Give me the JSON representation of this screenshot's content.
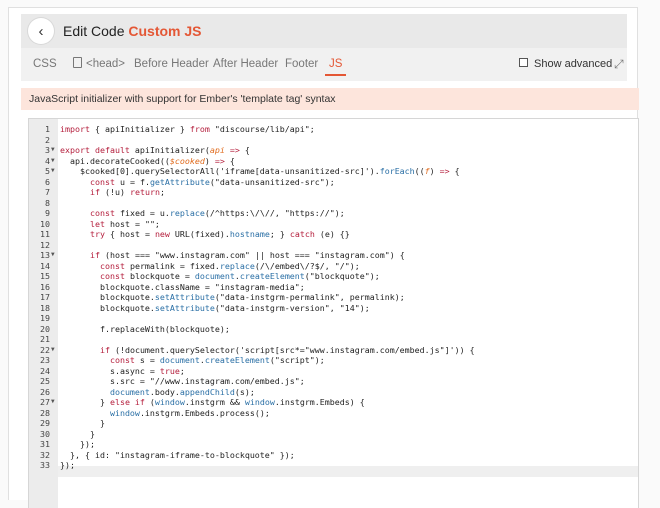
{
  "header": {
    "title_prefix": "Edit Code",
    "title_accent": "Custom JS",
    "back_icon": "chevron-left-icon"
  },
  "tabs": [
    {
      "label": "CSS",
      "active": false
    },
    {
      "label": "<head>",
      "active": false
    },
    {
      "label": "Before Header",
      "active": false
    },
    {
      "label": "After Header",
      "active": false
    },
    {
      "label": "Footer",
      "active": false
    },
    {
      "label": "JS",
      "active": true
    }
  ],
  "show_advanced": {
    "label": "Show advanced",
    "checked": false
  },
  "description": "JavaScript initializer with support for Ember's 'template tag' syntax",
  "colors": {
    "accent": "#e45735",
    "desc_bg": "#fde5dc"
  },
  "editor": {
    "active_line": 33,
    "lines": [
      {
        "n": "1",
        "fold": false,
        "html": "<span class=\"kw\">import</span> { apiInitializer } <span class=\"kw\">from</span> \"discourse/lib/api\";"
      },
      {
        "n": "2",
        "fold": false,
        "html": ""
      },
      {
        "n": "3",
        "fold": true,
        "html": "<span class=\"kw\">export default</span> apiInitializer(<span class=\"param\">api</span> <span class=\"kw\">=&gt;</span> {"
      },
      {
        "n": "4",
        "fold": true,
        "html": "  api.decorateCooked((<span class=\"param\">$cooked</span>) <span class=\"kw\">=&gt;</span> {"
      },
      {
        "n": "5",
        "fold": true,
        "html": "    $cooked[0].querySelectorAll('iframe[data-unsanitized-src]').<span class=\"fn\">forEach</span>((<span class=\"param\">f</span>) <span class=\"kw\">=&gt;</span> {"
      },
      {
        "n": "6",
        "fold": false,
        "html": "      <span class=\"kw\">const</span> u = f.<span class=\"fn\">getAttribute</span>(\"data-unsanitized-src\");"
      },
      {
        "n": "7",
        "fold": false,
        "html": "      <span class=\"kw\">if</span> (!u) <span class=\"kw\">return</span>;"
      },
      {
        "n": "8",
        "fold": false,
        "html": ""
      },
      {
        "n": "9",
        "fold": false,
        "html": "      <span class=\"kw\">const</span> fixed = u.<span class=\"fn\">replace</span>(/^https:\\/\\//, \"https://\");"
      },
      {
        "n": "10",
        "fold": false,
        "html": "      <span class=\"kw\">let</span> host = \"\";"
      },
      {
        "n": "11",
        "fold": false,
        "html": "      <span class=\"kw\">try</span> { host = <span class=\"kw\">new</span> URL(fixed).<span class=\"fn\">hostname</span>; } <span class=\"kw\">catch</span> (e) {}"
      },
      {
        "n": "12",
        "fold": false,
        "html": ""
      },
      {
        "n": "13",
        "fold": true,
        "html": "      <span class=\"kw\">if</span> (host === \"www.instagram.com\" || host === \"instagram.com\") {"
      },
      {
        "n": "14",
        "fold": false,
        "html": "        <span class=\"kw\">const</span> permalink = fixed.<span class=\"fn\">replace</span>(/\\/embed\\/?$/, \"/\");"
      },
      {
        "n": "15",
        "fold": false,
        "html": "        <span class=\"kw\">const</span> blockquote = <span class=\"fn\">document</span>.<span class=\"fn\">createElement</span>(\"blockquote\");"
      },
      {
        "n": "16",
        "fold": false,
        "html": "        blockquote.className = \"instagram-media\";"
      },
      {
        "n": "17",
        "fold": false,
        "html": "        blockquote.<span class=\"fn\">setAttribute</span>(\"data-instgrm-permalink\", permalink);"
      },
      {
        "n": "18",
        "fold": false,
        "html": "        blockquote.<span class=\"fn\">setAttribute</span>(\"data-instgrm-version\", \"14\");"
      },
      {
        "n": "19",
        "fold": false,
        "html": ""
      },
      {
        "n": "20",
        "fold": false,
        "html": "        f.replaceWith(blockquote);"
      },
      {
        "n": "21",
        "fold": false,
        "html": ""
      },
      {
        "n": "22",
        "fold": true,
        "html": "        <span class=\"kw\">if</span> (!document.querySelector('script[src*=\"www.instagram.com/embed.js\"]')) {"
      },
      {
        "n": "23",
        "fold": false,
        "html": "          <span class=\"kw\">const</span> s = <span class=\"fn\">document</span>.<span class=\"fn\">createElement</span>(\"script\");"
      },
      {
        "n": "24",
        "fold": false,
        "html": "          s.async = <span class=\"kw\">true</span>;"
      },
      {
        "n": "25",
        "fold": false,
        "html": "          s.src = \"//www.instagram.com/embed.js\";"
      },
      {
        "n": "26",
        "fold": false,
        "html": "          <span class=\"fn\">document</span>.body.<span class=\"fn\">appendChild</span>(s);"
      },
      {
        "n": "27",
        "fold": true,
        "html": "        } <span class=\"kw\">else if</span> (<span class=\"fn\">window</span>.instgrm &amp;&amp; <span class=\"fn\">window</span>.instgrm.Embeds) {"
      },
      {
        "n": "28",
        "fold": false,
        "html": "          <span class=\"fn\">window</span>.instgrm.Embeds.process();"
      },
      {
        "n": "29",
        "fold": false,
        "html": "        }"
      },
      {
        "n": "30",
        "fold": false,
        "html": "      }"
      },
      {
        "n": "31",
        "fold": false,
        "html": "    });"
      },
      {
        "n": "32",
        "fold": false,
        "html": "  }, { id: \"instagram-iframe-to-blockquote\" });"
      },
      {
        "n": "33",
        "fold": false,
        "html": "});"
      }
    ]
  }
}
